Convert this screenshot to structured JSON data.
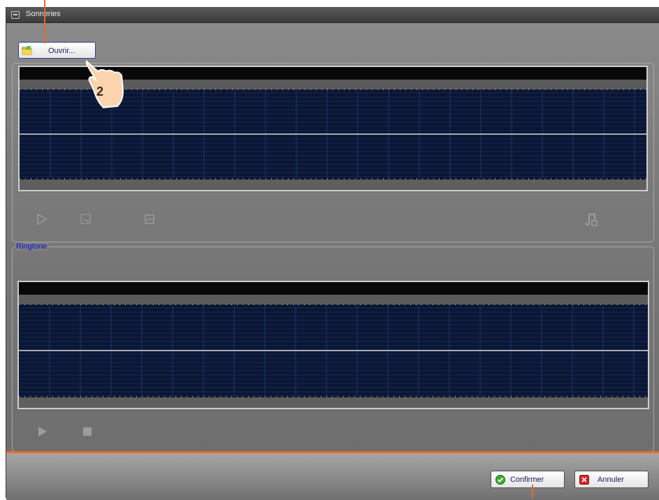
{
  "window": {
    "title": "Sonneries"
  },
  "toolbar": {
    "open_label": "Ouvrir..."
  },
  "ringtone": {
    "legend": "Ringtone"
  },
  "footer": {
    "confirm_label": "Confirmer",
    "cancel_label": "Annuler"
  },
  "callout": {
    "step": "2"
  },
  "colors": {
    "accent": "#e8692a",
    "legend": "#0b12d6",
    "waveform_bg": "#0d0d0d",
    "grid": "#1f3f78"
  },
  "icons": [
    "folder-icon",
    "play-icon",
    "record-icon",
    "stop-icon",
    "music-edit-icon",
    "confirm-check-icon",
    "cancel-x-icon",
    "window-menu-icon",
    "hand-pointer-icon"
  ]
}
